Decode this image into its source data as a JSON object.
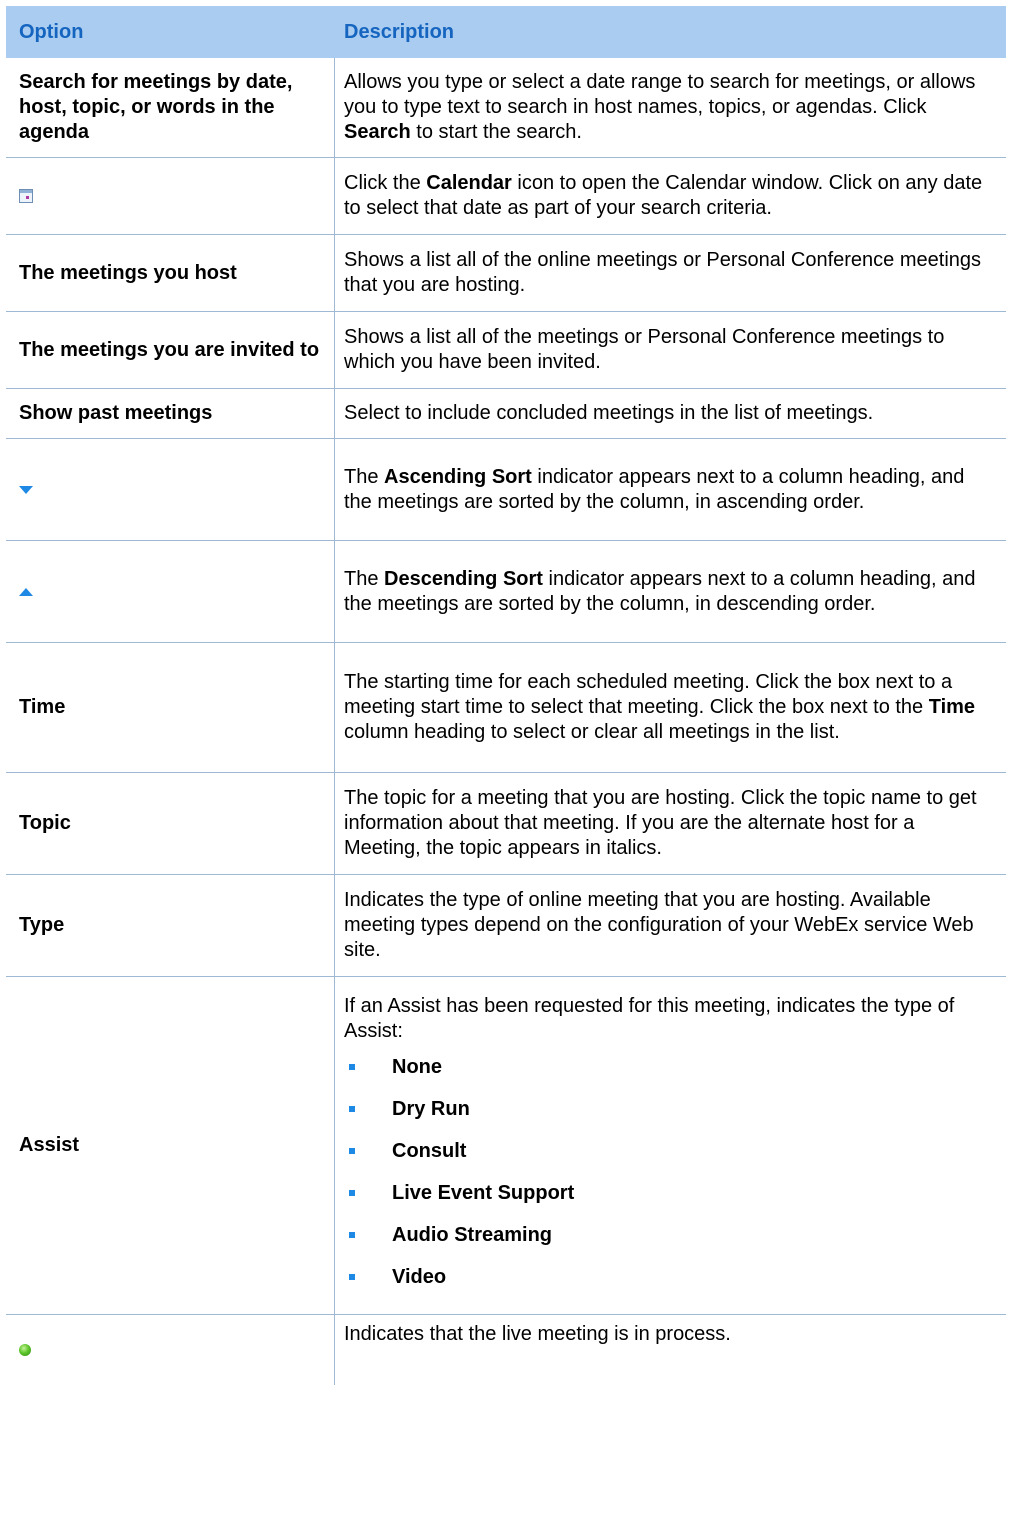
{
  "header": {
    "option": "Option",
    "description": "Description"
  },
  "rows": {
    "search": {
      "option": "Search for meetings by date, host, topic, or words in the agenda",
      "d1": "Allows you type or select a date range to search for meetings, or allows you to type text to search in host names, topics, or agendas. Click ",
      "b1": "Search",
      "d2": " to start the search."
    },
    "calendar": {
      "icon": "calendar-icon",
      "d1": "Click the ",
      "b1": "Calendar",
      "d2": " icon to open the Calendar window. Click on any date to select that date as part of your search criteria."
    },
    "host": {
      "option": "The meetings you host",
      "d1": "Shows a list all of the online meetings or Personal Conference meetings that you are hosting."
    },
    "invited": {
      "option": "The meetings you are invited to",
      "d1": "Shows a list all of the meetings or Personal Conference meetings to which you have been invited."
    },
    "past": {
      "option": "Show past meetings",
      "d1": "Select to include concluded meetings in the list of meetings."
    },
    "asc": {
      "icon": "ascending-sort-icon",
      "d1": "The ",
      "b1": "Ascending Sort",
      "d2": " indicator appears next to a column heading, and the meetings are sorted by the column, in ascending order."
    },
    "desc": {
      "icon": "descending-sort-icon",
      "d1": "The ",
      "b1": "Descending Sort",
      "d2": " indicator appears next to a column heading, and the meetings are sorted by the column, in descending order."
    },
    "time": {
      "option": "Time",
      "d1": "The starting time for each scheduled meeting. Click the box next to a meeting start time to select that meeting. Click the box next to the ",
      "b1": "Time",
      "d2": " column heading to select or clear all meetings in the list."
    },
    "topic": {
      "option": "Topic",
      "d1": "The topic for a meeting that you are hosting. Click the topic name to get information about that meeting. If you are the alternate host for a Meeting, the topic appears in italics."
    },
    "type": {
      "option": "Type",
      "d1": "Indicates the type of online meeting that you are hosting. Available meeting types depend on the configuration of your WebEx service Web site."
    },
    "assist": {
      "option": "Assist",
      "d1": "If an Assist has been requested for this meeting, indicates the type of Assist:",
      "items": [
        "None",
        "Dry Run",
        "Consult",
        "Live Event Support",
        "Audio Streaming",
        "Video"
      ]
    },
    "live": {
      "icon": "live-meeting-icon",
      "d1": "Indicates that the live meeting is in process."
    }
  },
  "colors": {
    "header_bg": "#a9ccf0",
    "header_text": "#1565c0",
    "bullet": "#1e88e5",
    "rule": "#9fb9d4"
  }
}
